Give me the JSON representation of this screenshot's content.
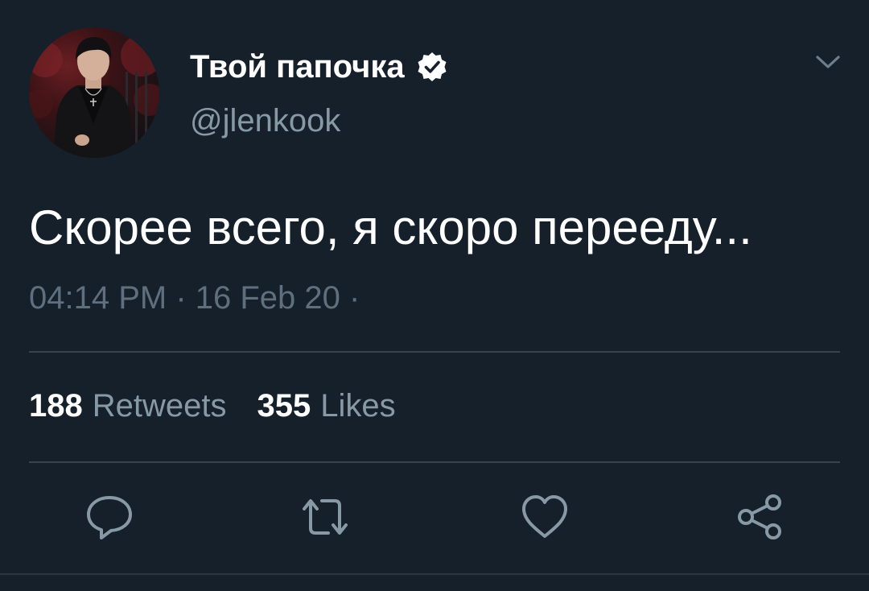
{
  "tweet": {
    "display_name": "Твой папочка",
    "verified": true,
    "handle": "@jlenkook",
    "text": "Скорее всего, я скоро перееду...",
    "meta": "04:14 PM · 16 Feb 20 ·",
    "stats": {
      "retweets_count": "188",
      "retweets_label": "Retweets",
      "likes_count": "355",
      "likes_label": "Likes"
    },
    "actions": [
      "reply-icon",
      "retweet-icon",
      "like-icon",
      "share-icon"
    ],
    "colors": {
      "background": "#15202b",
      "primary_text": "#ffffff",
      "secondary_text": "#8899a6",
      "divider": "#38444d",
      "icon": "#8899a6"
    }
  }
}
